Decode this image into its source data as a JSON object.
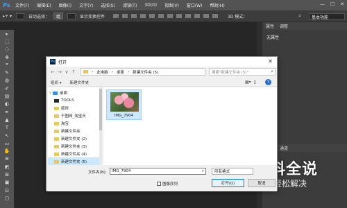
{
  "app": {
    "logo": "Ps",
    "menu": [
      "文件(F)",
      "编辑(E)",
      "图像(I)",
      "文字(Y)",
      "选择(S)",
      "滤镜(T)",
      "3D(D)",
      "视图(V)",
      "窗口(W)",
      "帮助(H)"
    ],
    "window_controls": [
      "—",
      "☐",
      "✕"
    ]
  },
  "options_bar": {
    "auto_select_label": "自动选择：",
    "auto_select_value": "组",
    "show_transform_label": "显示变换控件",
    "mode_3d_label": "3D 模式：",
    "workspace": "基本功能"
  },
  "panels": {
    "tabs_top": [
      "属性",
      "调整"
    ],
    "attributes_label": "无属性",
    "tabs_bottom": [
      "图层",
      "通道"
    ]
  },
  "tools": [
    "▸",
    "⬚",
    "◌",
    "✥",
    "⌗",
    "✎",
    "◍",
    "✐",
    "▤",
    "◐",
    "✒",
    "▲",
    "T",
    "↖",
    "▭",
    "✋",
    "⊕",
    "◩",
    "⊞",
    "▣",
    "⊡",
    "▢"
  ],
  "dialog": {
    "title": "打开",
    "close": "✕",
    "nav": {
      "back": "←",
      "forward": "→",
      "up_dropdown": "∨",
      "up": "↑"
    },
    "path": [
      "此电脑",
      "桌面",
      "新建文件夹 (5)"
    ],
    "path_sep": "›",
    "search_placeholder": "搜索\"新建文件夹 (5)\"",
    "organize": "组织 ▾",
    "new_folder": "新建文件夹",
    "help": "?",
    "nav_items": [
      {
        "label": "桌面",
        "icon": "blue",
        "caret": "∨"
      },
      {
        "label": "TOOLS",
        "icon": "tools",
        "caret": ""
      },
      {
        "label": "临时",
        "icon": "",
        "caret": ""
      },
      {
        "label": "千图网_淘宝天",
        "icon": "",
        "caret": ""
      },
      {
        "label": "淘宝",
        "icon": "",
        "caret": ""
      },
      {
        "label": "新建文件夹",
        "icon": "",
        "caret": ""
      },
      {
        "label": "新建文件夹 (2)",
        "icon": "",
        "caret": ""
      },
      {
        "label": "新建文件夹 (3)",
        "icon": "",
        "caret": ""
      },
      {
        "label": "新建文件夹 (4)",
        "icon": "",
        "caret": ""
      },
      {
        "label": "新建文件夹 (5)",
        "icon": "",
        "caret": "",
        "selected": true
      }
    ],
    "files": [
      {
        "name": "IMG_7904"
      }
    ],
    "filename_label": "文件名(N):",
    "filename_value": "IMG_7904",
    "format_value": "所有格式",
    "image_sequence": "图像序列",
    "open_button": "打开(O)",
    "cancel_button": "取消"
  },
  "watermark": {
    "title": "百科全说",
    "subtitle": "助你轻松解决"
  }
}
